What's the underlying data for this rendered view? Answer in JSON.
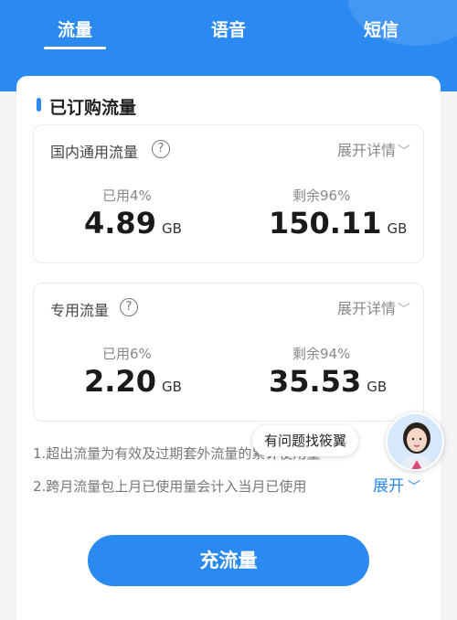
{
  "tabs": [
    {
      "label": "流量",
      "active": true
    },
    {
      "label": "语音",
      "active": false
    },
    {
      "label": "短信",
      "active": false
    }
  ],
  "section": {
    "title": "已订购流量"
  },
  "cards": [
    {
      "label": "国内通用流量",
      "expand": "展开详情",
      "used_label": "已用4%",
      "used_value": "4.89",
      "used_unit": "GB",
      "remain_label": "剩余96%",
      "remain_value": "150.11",
      "remain_unit": "GB"
    },
    {
      "label": "专用流量",
      "expand": "展开详情",
      "used_label": "已用6%",
      "used_value": "2.20",
      "used_unit": "GB",
      "remain_label": "剩余94%",
      "remain_value": "35.53",
      "remain_unit": "GB"
    }
  ],
  "notes": [
    "1.超出流量为有效及过期套外流量的累计使用量",
    "2.跨月流量包上月已使用量会计入当月已使用"
  ],
  "notes_expand": "展开",
  "assistant": {
    "tooltip": "有问题找筱翼"
  },
  "recharge_button": "充流量",
  "icons": {
    "help": "help-circle-icon",
    "chevron": "chevron-down-icon"
  },
  "colors": {
    "accent": "#2b8af2",
    "background": "#f3f4f6"
  }
}
